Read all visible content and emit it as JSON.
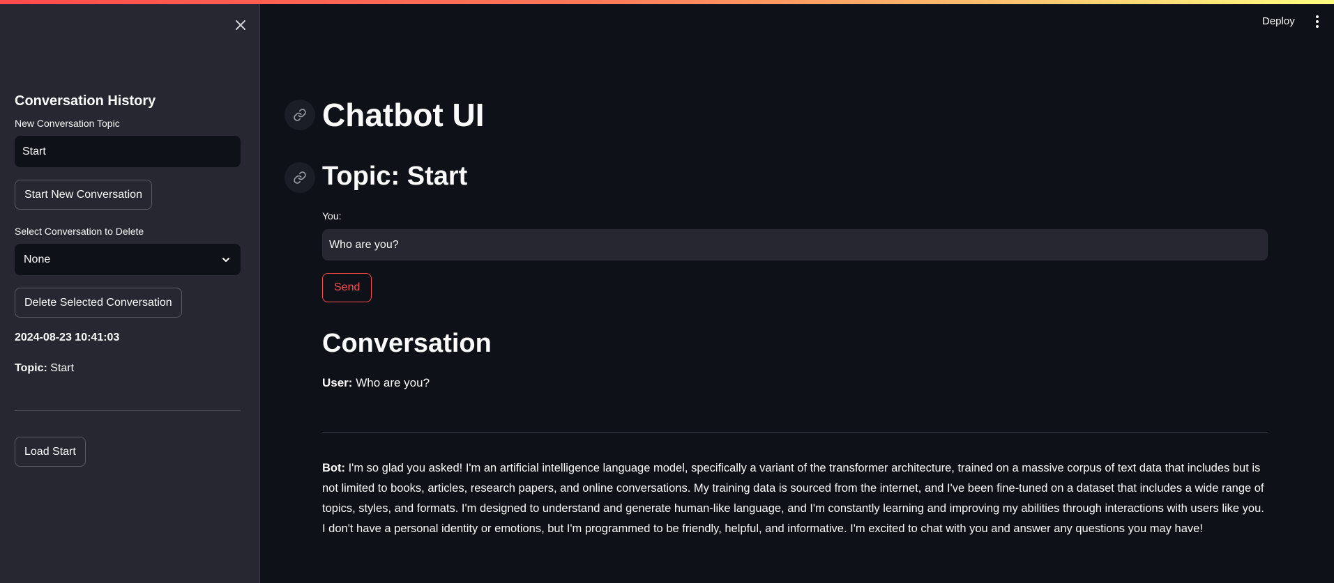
{
  "sidebar": {
    "heading": "Conversation History",
    "new_topic_label": "New Conversation Topic",
    "new_topic_value": "Start",
    "start_button": "Start New Conversation",
    "delete_select_label": "Select Conversation to Delete",
    "delete_select_value": "None",
    "delete_button": "Delete Selected Conversation",
    "history": [
      {
        "timestamp": "2024-08-23 10:41:03",
        "topic_label": "Topic:",
        "topic_value": "Start",
        "load_button": "Load Start"
      }
    ]
  },
  "header": {
    "deploy": "Deploy"
  },
  "main": {
    "title": "Chatbot UI",
    "topic_heading": "Topic: Start",
    "input_label": "You:",
    "input_value": "Who are you?",
    "send_button": "Send",
    "conversation_heading": "Conversation",
    "messages": [
      {
        "speaker": "User:",
        "text": "Who are you?"
      },
      {
        "speaker": "Bot:",
        "text": "I'm so glad you asked! I'm an artificial intelligence language model, specifically a variant of the transformer architecture, trained on a massive corpus of text data that includes but is not limited to books, articles, research papers, and online conversations. My training data is sourced from the internet, and I've been fine-tuned on a dataset that includes a wide range of topics, styles, and formats. I'm designed to understand and generate human-like language, and I'm constantly learning and improving my abilities through interactions with users like you. I don't have a personal identity or emotions, but I'm programmed to be friendly, helpful, and informative. I'm excited to chat with you and answer any questions you may have!"
      }
    ]
  },
  "colors": {
    "background": "#0e1117",
    "sidebar": "#262730",
    "accent": "#ff4b4b"
  },
  "icons": {
    "close": "close-icon",
    "link": "link-icon",
    "chevron": "chevron-down-icon",
    "menu": "more-vertical-icon"
  }
}
